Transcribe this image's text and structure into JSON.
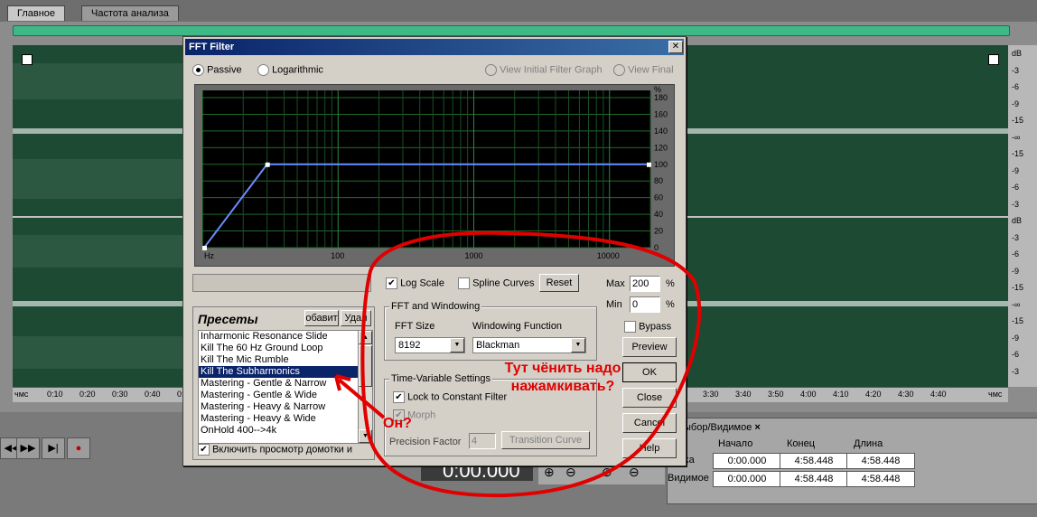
{
  "tabs": [
    {
      "label": "Главное"
    },
    {
      "label": "Частота анализа"
    }
  ],
  "ruler": {
    "left": [
      "чмс",
      "0:10",
      "0:20",
      "0:30",
      "0:40",
      "0:5"
    ],
    "right": [
      "3:30",
      "3:40",
      "3:50",
      "4:00",
      "4:10",
      "4:20",
      "4:30",
      "4:40",
      "чмс"
    ]
  },
  "db_scale": [
    "dB",
    "-3",
    "-6",
    "-9",
    "-15",
    "-∞",
    "-15",
    "-9",
    "-6",
    "-3",
    "dB",
    "-3",
    "-6",
    "-9",
    "-15",
    "-∞",
    "-15",
    "-9",
    "-6",
    "-3"
  ],
  "bottom": {
    "time_display": "0:00.000",
    "selection_tab": "ыбор/Видимое",
    "selection_close": "×",
    "headers": {
      "start": "Начало",
      "end": "Конец",
      "length": "Длина"
    },
    "rows": [
      {
        "label": "борка",
        "start": "0:00.000",
        "end": "4:58.448",
        "length": "4:58.448"
      },
      {
        "label": "Видимое",
        "start": "0:00.000",
        "end": "4:58.448",
        "length": "4:58.448"
      }
    ],
    "transport": [
      "◀◀",
      "▶▶",
      "▶|",
      "●"
    ]
  },
  "dialog": {
    "title": "FFT Filter",
    "close": "✕",
    "mode": {
      "passive": "Passive",
      "logarithmic": "Logarithmic",
      "view_initial": "View Initial Filter Graph",
      "view_final": "View Final"
    },
    "graph": {
      "y_unit": "%",
      "y_ticks": [
        "180",
        "160",
        "140",
        "120",
        "100",
        "80",
        "60",
        "40",
        "20",
        "0"
      ],
      "x_ticks": [
        "Hz",
        "100",
        "1000",
        "10000"
      ]
    },
    "log_scale": "Log Scale",
    "spline_curves": "Spline Curves",
    "reset": "Reset",
    "max_label": "Max",
    "max_value": "200",
    "min_label": "Min",
    "min_value": "0",
    "pct": "%",
    "fft_group": "FFT and Windowing",
    "fft_size_label": "FFT Size",
    "fft_size": "8192",
    "windowing_label": "Windowing Function",
    "windowing": "Blackman",
    "bypass": "Bypass",
    "preview": "Preview",
    "ok": "OK",
    "close_btn": "Close",
    "cancel": "Cancel",
    "help": "Help",
    "tv_group": "Time-Variable Settings",
    "lock_constant": "Lock to Constant Filter",
    "morph": "Morph",
    "precision_label": "Precision Factor",
    "precision_value": "4",
    "transition_curve": "Transition Curve",
    "presets_title": "Пресеты",
    "add_btn": "обавит",
    "del_btn": "Удал",
    "presets": [
      "Inharmonic Resonance Slide",
      "Kill The 60 Hz  Ground Loop",
      "Kill The Mic Rumble",
      "Kill The Subharmonics",
      "Mastering - Gentle & Narrow",
      "Mastering - Gentle & Wide",
      "Mastering - Heavy & Narrow",
      "Mastering - Heavy & Wide",
      "OnHold 400-->4k"
    ],
    "selected_preset": 3,
    "preview_toggle": "Включить просмотр домотки и"
  },
  "annotations": {
    "on": "Он?",
    "note": "Тут чёнить надо нажамкивать?"
  },
  "colors": {
    "wave": "#1c4a32",
    "graph_bg": "#000000",
    "curve": "#6a8cff",
    "annotation": "#e00000",
    "title": "#0a246a"
  }
}
